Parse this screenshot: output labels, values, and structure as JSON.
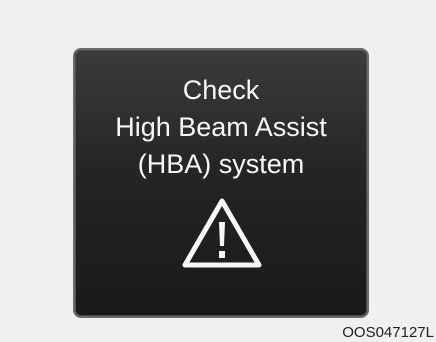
{
  "warning": {
    "line1": "Check",
    "line2": "High Beam Assist",
    "line3": "(HBA) system",
    "icon": "warning-triangle-icon"
  },
  "footer": {
    "code": "OOS047127L"
  },
  "colors": {
    "page_background": "#f0f0f0",
    "panel_top": "#3b3b3b",
    "panel_bottom": "#191919",
    "text": "#f7f7f7"
  }
}
